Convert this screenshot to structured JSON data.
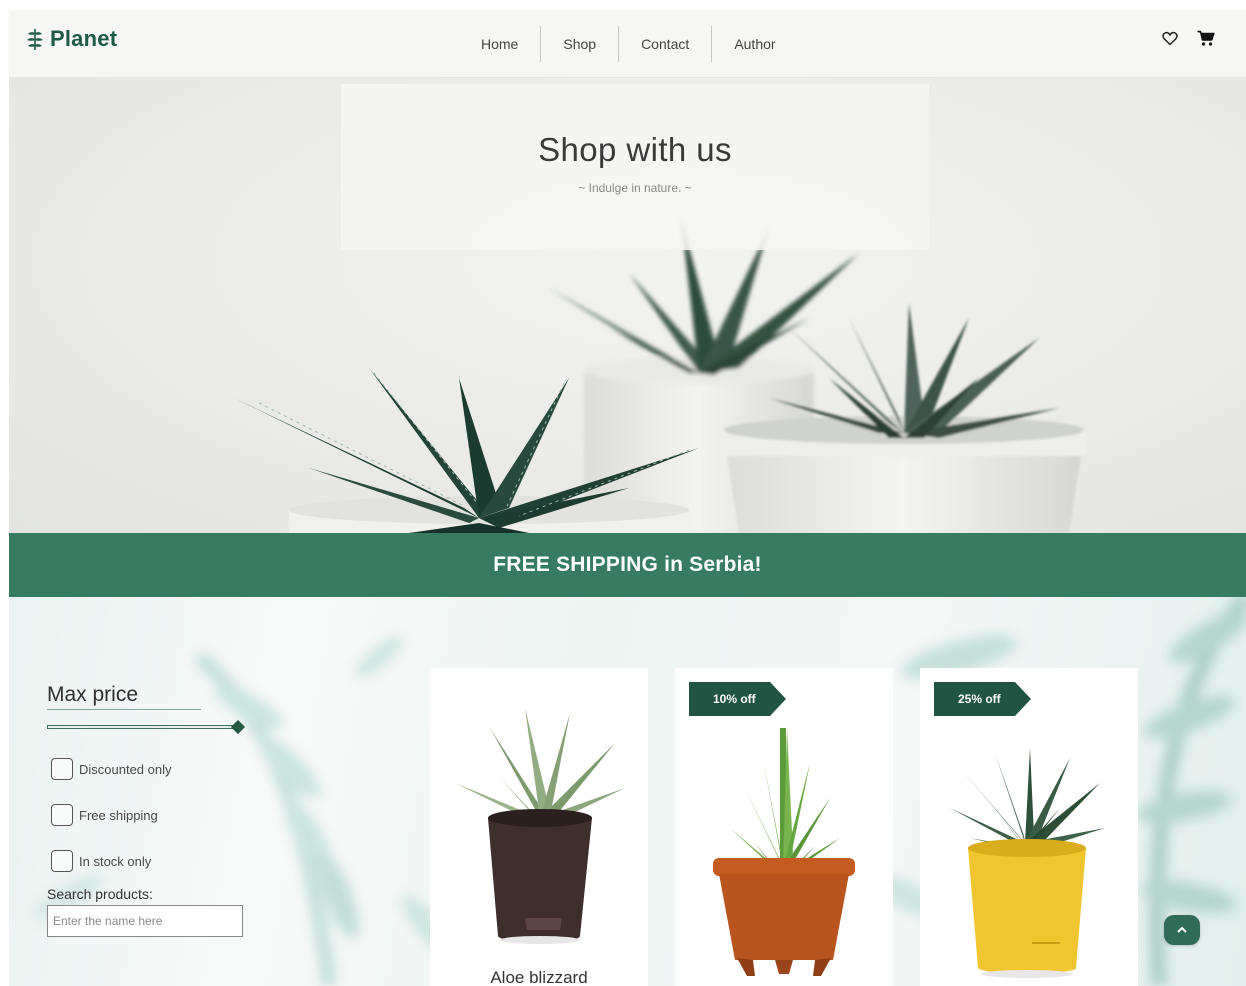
{
  "header": {
    "logo_text": "Planet",
    "logo_icon": "leaf-sprig-icon",
    "nav": [
      {
        "label": "Home"
      },
      {
        "label": "Shop"
      },
      {
        "label": "Contact"
      },
      {
        "label": "Author"
      }
    ],
    "icons": [
      "heart-icon",
      "cart-icon"
    ]
  },
  "hero": {
    "title": "Shop with us",
    "subtitle": "~ Indulge in nature. ~"
  },
  "banner": {
    "text": "FREE SHIPPING in Serbia!"
  },
  "filters": {
    "max_price_label": "Max price",
    "max_price_value": 1.0,
    "checkboxes": [
      {
        "label": "Discounted only",
        "checked": false
      },
      {
        "label": "Free shipping",
        "checked": false
      },
      {
        "label": "In stock only",
        "checked": false
      }
    ],
    "search_label": "Search products:",
    "search_placeholder": "Enter the name here",
    "search_value": ""
  },
  "products": [
    {
      "name": "Aloe blizzard",
      "badge": "",
      "pot_color": "#3e2f2c"
    },
    {
      "name": "",
      "badge": "10% off",
      "pot_color": "#b8541e"
    },
    {
      "name": "",
      "badge": "25% off",
      "pot_color": "#f0c630"
    }
  ],
  "colors": {
    "brand_green": "#1f5a46",
    "banner_green": "#367b62",
    "badge_green": "#215443"
  },
  "scroll_top_icon": "chevron-up-icon"
}
